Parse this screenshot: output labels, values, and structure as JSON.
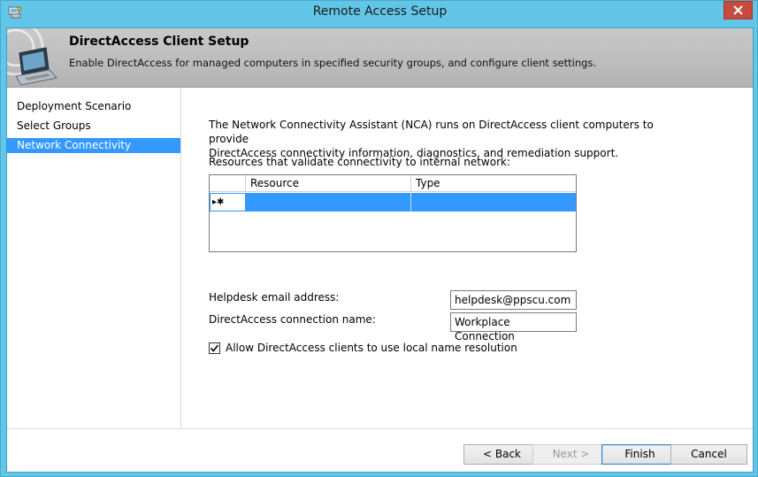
{
  "window": {
    "title": "Remote Access Setup",
    "close_icon": "close-icon",
    "title_icon": "setup-wizard-icon"
  },
  "header": {
    "title": "DirectAccess Client Setup",
    "subtitle": "Enable DirectAccess for managed computers in specified security groups, and configure client settings.",
    "image_icon": "laptop-network-icon"
  },
  "nav": {
    "items": [
      {
        "label": "Deployment Scenario",
        "active": false
      },
      {
        "label": "Select Groups",
        "active": false
      },
      {
        "label": "Network Connectivity Assistant",
        "active": true
      }
    ]
  },
  "content": {
    "description_line1": "The Network Connectivity Assistant (NCA) runs on DirectAccess client computers to provide",
    "description_line2": "DirectAccess connectivity information, diagnostics, and remediation support.",
    "grid_label": "Resources that validate connectivity to internal network:",
    "grid": {
      "columns": [
        "Resource",
        "Type"
      ],
      "new_row_marker": "▸✱",
      "rows": [
        {
          "resource": "",
          "type": ""
        }
      ]
    },
    "helpdesk_label": "Helpdesk email address:",
    "helpdesk_value": "helpdesk@ppscu.com",
    "connection_label": "DirectAccess connection name:",
    "connection_value": "Workplace Connection",
    "local_resolution_label": "Allow DirectAccess clients to use local name resolution",
    "local_resolution_checked": true
  },
  "footer": {
    "back_label": "< Back",
    "next_label": "Next >",
    "finish_label": "Finish",
    "cancel_label": "Cancel"
  },
  "colors": {
    "frame": "#62c6e8",
    "selection": "#3399ff",
    "close": "#c74a3d"
  }
}
